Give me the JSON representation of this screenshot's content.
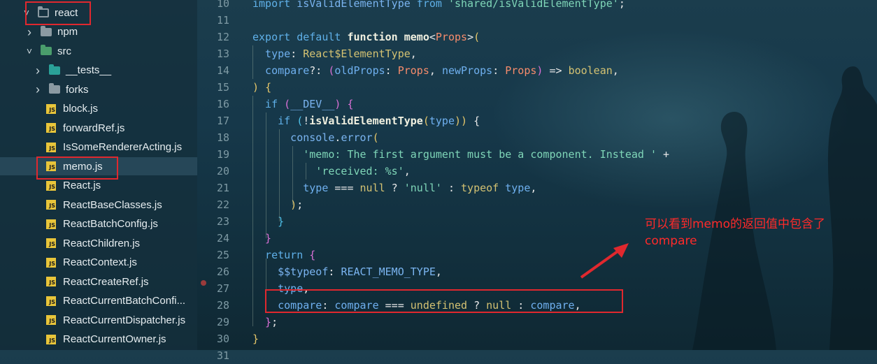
{
  "explorer": {
    "items": [
      {
        "label": "react",
        "kind": "folder-open",
        "chevron": "v",
        "indent": 0
      },
      {
        "label": "npm",
        "kind": "folder",
        "chevron": ">",
        "indent": 1
      },
      {
        "label": "src",
        "kind": "folder-src",
        "chevron": "v",
        "indent": 1
      },
      {
        "label": "__tests__",
        "kind": "folder-tests",
        "chevron": ">",
        "indent": 2
      },
      {
        "label": "forks",
        "kind": "folder",
        "chevron": ">",
        "indent": 2
      },
      {
        "label": "block.js",
        "kind": "js",
        "indent": 2
      },
      {
        "label": "forwardRef.js",
        "kind": "js",
        "indent": 2
      },
      {
        "label": "IsSomeRendererActing.js",
        "kind": "js",
        "indent": 2
      },
      {
        "label": "memo.js",
        "kind": "js",
        "indent": 2,
        "selected": true
      },
      {
        "label": "React.js",
        "kind": "js",
        "indent": 2
      },
      {
        "label": "ReactBaseClasses.js",
        "kind": "js",
        "indent": 2
      },
      {
        "label": "ReactBatchConfig.js",
        "kind": "js",
        "indent": 2
      },
      {
        "label": "ReactChildren.js",
        "kind": "js",
        "indent": 2
      },
      {
        "label": "ReactContext.js",
        "kind": "js",
        "indent": 2
      },
      {
        "label": "ReactCreateRef.js",
        "kind": "js",
        "indent": 2
      },
      {
        "label": "ReactCurrentBatchConfi...",
        "kind": "js",
        "indent": 2
      },
      {
        "label": "ReactCurrentDispatcher.js",
        "kind": "js",
        "indent": 2
      },
      {
        "label": "ReactCurrentOwner.js",
        "kind": "js",
        "indent": 2
      }
    ]
  },
  "editor": {
    "lines": [
      {
        "n": "10",
        "tokens": [
          [
            "kw",
            "import "
          ],
          [
            "const",
            "isValidElementType"
          ],
          [
            "kw",
            " from "
          ],
          [
            "str",
            "'shared/isValidElementType'"
          ],
          [
            "punc",
            ";"
          ]
        ]
      },
      {
        "n": "11",
        "tokens": []
      },
      {
        "n": "12",
        "tokens": [
          [
            "kw",
            "export default "
          ],
          [
            "fn",
            "function "
          ],
          [
            "fn",
            "memo"
          ],
          [
            "punc",
            "<"
          ],
          [
            "type",
            "Props"
          ],
          [
            "punc",
            ">"
          ],
          [
            "brk",
            "("
          ]
        ]
      },
      {
        "n": "13",
        "tokens": [
          [
            "prop",
            "  type"
          ],
          [
            "punc",
            ": "
          ],
          [
            "bool",
            "React$ElementType"
          ],
          [
            "punc",
            ","
          ]
        ]
      },
      {
        "n": "14",
        "tokens": [
          [
            "prop",
            "  compare"
          ],
          [
            "punc",
            "?: "
          ],
          [
            "paren",
            "("
          ],
          [
            "prop",
            "oldProps"
          ],
          [
            "punc",
            ": "
          ],
          [
            "type",
            "Props"
          ],
          [
            "punc",
            ", "
          ],
          [
            "prop",
            "newProps"
          ],
          [
            "punc",
            ": "
          ],
          [
            "type",
            "Props"
          ],
          [
            "paren",
            ")"
          ],
          [
            "punc",
            " => "
          ],
          [
            "bool",
            "boolean"
          ],
          [
            "punc",
            ","
          ]
        ]
      },
      {
        "n": "15",
        "tokens": [
          [
            "brk",
            ")"
          ],
          [
            "punc",
            " "
          ],
          [
            "brk",
            "{"
          ]
        ]
      },
      {
        "n": "16",
        "tokens": [
          [
            "kw",
            "  if "
          ],
          [
            "paren",
            "("
          ],
          [
            "const",
            "__DEV__"
          ],
          [
            "paren",
            ")"
          ],
          [
            "punc",
            " "
          ],
          [
            "paren",
            "{"
          ]
        ]
      },
      {
        "n": "17",
        "tokens": [
          [
            "kw",
            "    if "
          ],
          [
            "kw2",
            "("
          ],
          [
            "punc",
            "!"
          ],
          [
            "fn",
            "isValidElementType"
          ],
          [
            "brk",
            "("
          ],
          [
            "prop",
            "type"
          ],
          [
            "brk",
            "))"
          ],
          [
            "punc",
            " {"
          ]
        ]
      },
      {
        "n": "18",
        "tokens": [
          [
            "const",
            "      console"
          ],
          [
            "punc",
            "."
          ],
          [
            "const",
            "error"
          ],
          [
            "brk",
            "("
          ]
        ]
      },
      {
        "n": "19",
        "tokens": [
          [
            "str",
            "        'memo: The first argument must be a component. Instead ' "
          ],
          [
            "punc",
            "+"
          ]
        ]
      },
      {
        "n": "20",
        "tokens": [
          [
            "str",
            "          'received: %s'"
          ],
          [
            "punc",
            ","
          ]
        ]
      },
      {
        "n": "21",
        "tokens": [
          [
            "prop",
            "        type"
          ],
          [
            "punc",
            " === "
          ],
          [
            "bool",
            "null"
          ],
          [
            "punc",
            " ? "
          ],
          [
            "str",
            "'null'"
          ],
          [
            "punc",
            " : "
          ],
          [
            "bool",
            "typeof "
          ],
          [
            "prop",
            "type"
          ],
          [
            "punc",
            ","
          ]
        ]
      },
      {
        "n": "22",
        "tokens": [
          [
            "brk",
            "      )"
          ],
          [
            "punc",
            ";"
          ]
        ]
      },
      {
        "n": "23",
        "tokens": [
          [
            "kw2",
            "    }"
          ]
        ]
      },
      {
        "n": "24",
        "tokens": [
          [
            "paren",
            "  }"
          ]
        ]
      },
      {
        "n": "25",
        "tokens": [
          [
            "kw",
            "  return "
          ],
          [
            "paren",
            "{"
          ]
        ]
      },
      {
        "n": "26",
        "tokens": [
          [
            "const",
            "    $$typeof"
          ],
          [
            "punc",
            ": "
          ],
          [
            "const",
            "REACT_MEMO_TYPE"
          ],
          [
            "punc",
            ","
          ]
        ]
      },
      {
        "n": "27",
        "tokens": [
          [
            "prop",
            "    type"
          ],
          [
            "punc",
            ","
          ]
        ]
      },
      {
        "n": "28",
        "tokens": [
          [
            "prop",
            "    compare"
          ],
          [
            "punc",
            ": "
          ],
          [
            "prop",
            "compare"
          ],
          [
            "punc",
            " === "
          ],
          [
            "bool",
            "undefined"
          ],
          [
            "punc",
            " ? "
          ],
          [
            "bool",
            "null"
          ],
          [
            "punc",
            " : "
          ],
          [
            "prop",
            "compare"
          ],
          [
            "punc",
            ","
          ]
        ]
      },
      {
        "n": "29",
        "tokens": [
          [
            "paren",
            "  }"
          ],
          [
            "punc",
            ";"
          ]
        ]
      },
      {
        "n": "30",
        "tokens": [
          [
            "brk",
            "}"
          ]
        ]
      },
      {
        "n": "31",
        "tokens": []
      }
    ]
  },
  "annotation": {
    "line1": "可以看到memo的返回值中包含了",
    "line2": "compare",
    "color": "#ff2a2a"
  }
}
